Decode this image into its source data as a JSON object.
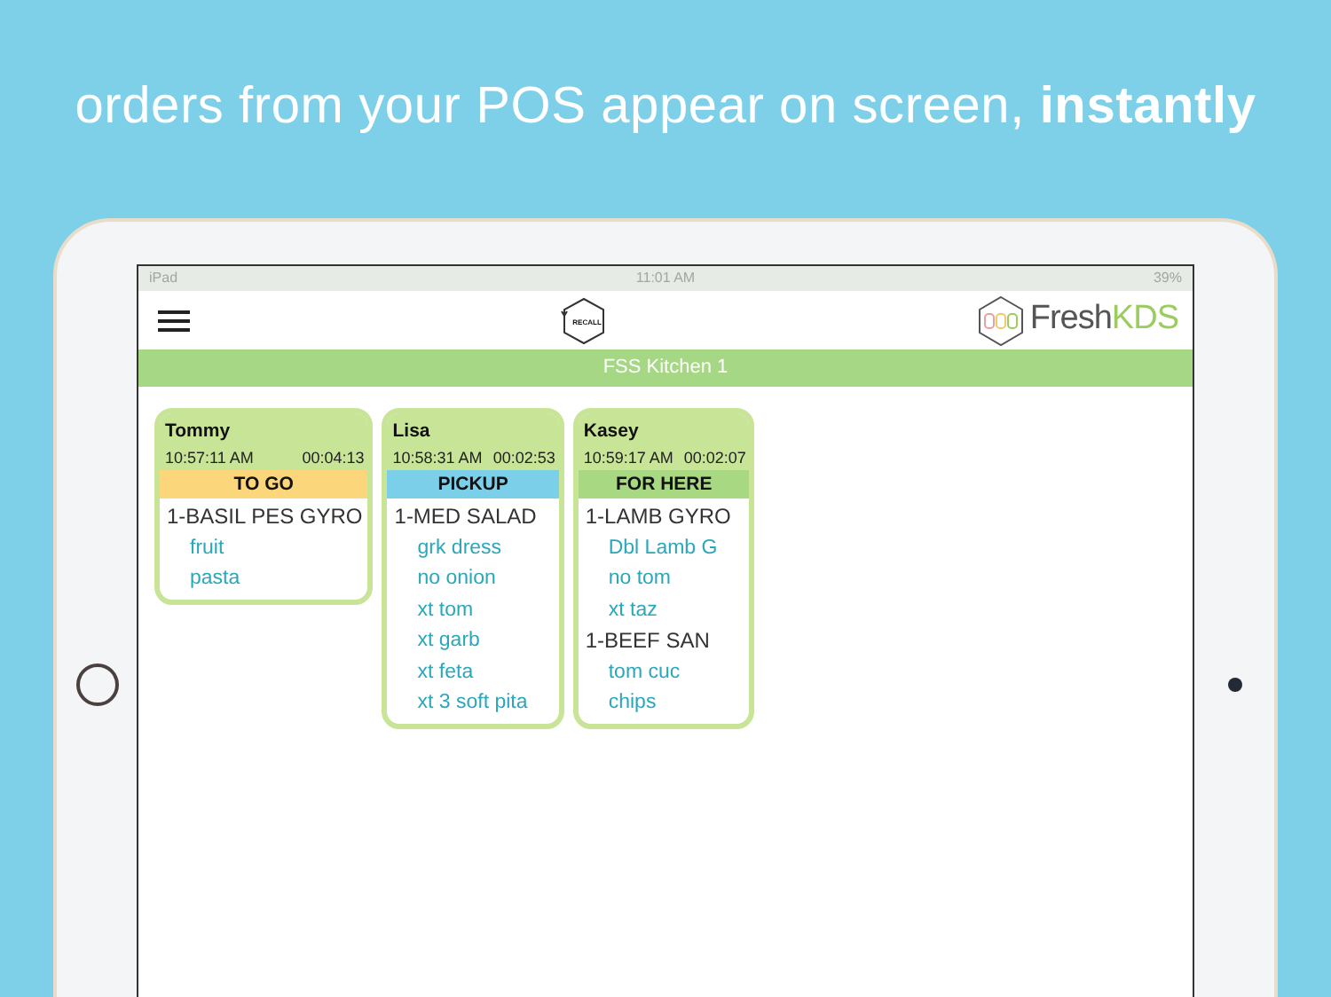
{
  "headline": {
    "text": "orders from your POS appear on screen, **instantly**"
  },
  "status_bar": {
    "device": "iPad",
    "time": "11:01 AM",
    "battery": "39%"
  },
  "header": {
    "recall_label": "RECALL",
    "logo_text": "Fresh",
    "logo_accent": "KDS"
  },
  "station": {
    "title": "FSS Kitchen 1"
  },
  "orders": [
    {
      "name": "Tommy",
      "time": "10:57:11 AM",
      "elapsed": "00:04:13",
      "type": "TO GO",
      "color": "#fcd67a",
      "items": [
        {
          "text": "1-BASIL PES GYRO",
          "children": [
            {
              "text": "fruit"
            },
            {
              "text": "pasta"
            }
          ]
        }
      ]
    },
    {
      "name": "Lisa",
      "time": "10:58:31 AM",
      "elapsed": "00:02:53",
      "type": "PICKUP",
      "color": "#7ccfe9",
      "items": [
        {
          "text": "1-MED SALAD",
          "children": [
            {
              "text": "grk dress"
            },
            {
              "text": "no onion"
            },
            {
              "text": "xt tom"
            },
            {
              "text": "xt garb"
            },
            {
              "text": "xt feta"
            },
            {
              "text": "xt 3 soft pita"
            }
          ]
        }
      ]
    },
    {
      "name": "Kasey",
      "time": "10:59:17 AM",
      "elapsed": "00:02:07",
      "type": "FOR HERE",
      "color": "#a8d882",
      "items": [
        {
          "text": "1-LAMB GYRO",
          "children": [
            {
              "text": "Dbl Lamb G"
            },
            {
              "text": "no tom"
            },
            {
              "text": "xt taz"
            }
          ]
        },
        {
          "text": "1-BEEF SAN",
          "children": [
            {
              "text": "tom cuc"
            },
            {
              "text": "chips"
            }
          ]
        }
      ]
    }
  ]
}
